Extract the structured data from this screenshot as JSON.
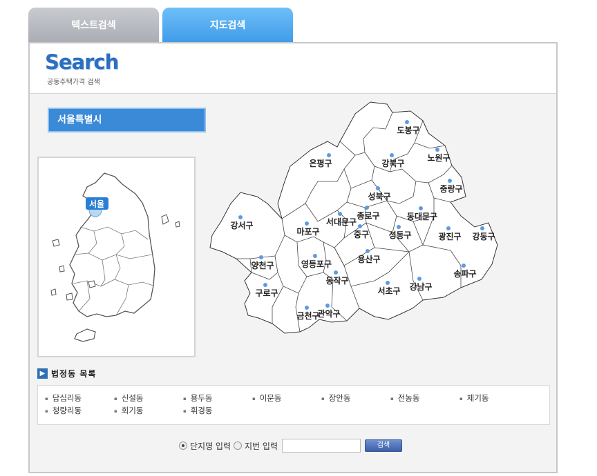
{
  "tabs": [
    {
      "label": "텍스트검색",
      "active": false
    },
    {
      "label": "지도검색",
      "active": true
    }
  ],
  "header": {
    "logo": "Search",
    "subtitle": "공동주택가격 검색"
  },
  "region": {
    "selected": "서울특별시",
    "map_marker": "서울"
  },
  "districts": [
    "도봉구",
    "노원구",
    "강북구",
    "은평구",
    "성북구",
    "중랑구",
    "종로구",
    "동대문구",
    "서대문구",
    "강서구",
    "마포구",
    "중구",
    "성동구",
    "광진구",
    "강동구",
    "용산구",
    "양천구",
    "영등포구",
    "동작구",
    "송파구",
    "강남구",
    "구로구",
    "서초구",
    "관악구",
    "금천구"
  ],
  "dong_list": {
    "title": "법정동 목록",
    "items": [
      "답십리동",
      "신설동",
      "용두동",
      "이문동",
      "장안동",
      "전농동",
      "제기동",
      "청량리동",
      "회기동",
      "휘경동"
    ]
  },
  "search": {
    "option_complex": "단지명 입력",
    "option_lot": "지번 입력",
    "input_value": "",
    "button_label": "검색",
    "selected_option": "단지명 입력"
  },
  "colors": {
    "accent": "#3a8ad8",
    "tab_active": "#4fa8ef",
    "tab_inactive": "#b8bbc1"
  }
}
